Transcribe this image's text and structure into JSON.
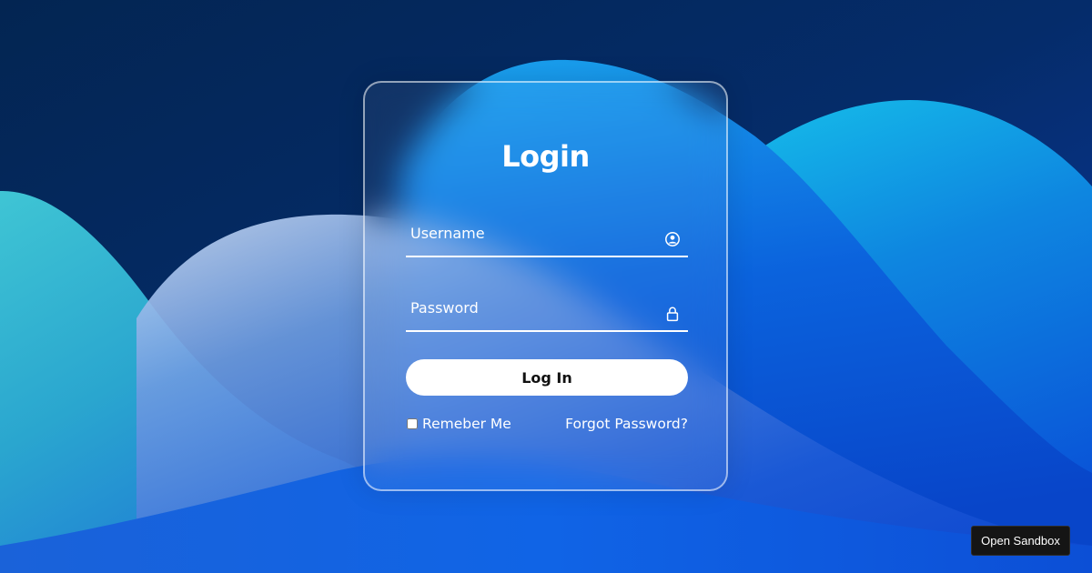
{
  "form": {
    "title": "Login",
    "username_placeholder": "Username",
    "password_placeholder": "Password",
    "username_icon": "user-circle-icon",
    "password_icon": "lock-icon",
    "login_button_label": "Log In",
    "remember_label": "Remeber Me",
    "remember_checked": false,
    "forgot_label": "Forgot Password?"
  },
  "footer": {
    "sandbox_button_label": "Open Sandbox"
  },
  "colors": {
    "background_dark": "#062a6e",
    "wave_light": "#2fb6d9",
    "card_border": "#ffffff",
    "button_bg": "#ffffff",
    "button_text": "#111111",
    "sandbox_bg": "#151515"
  }
}
